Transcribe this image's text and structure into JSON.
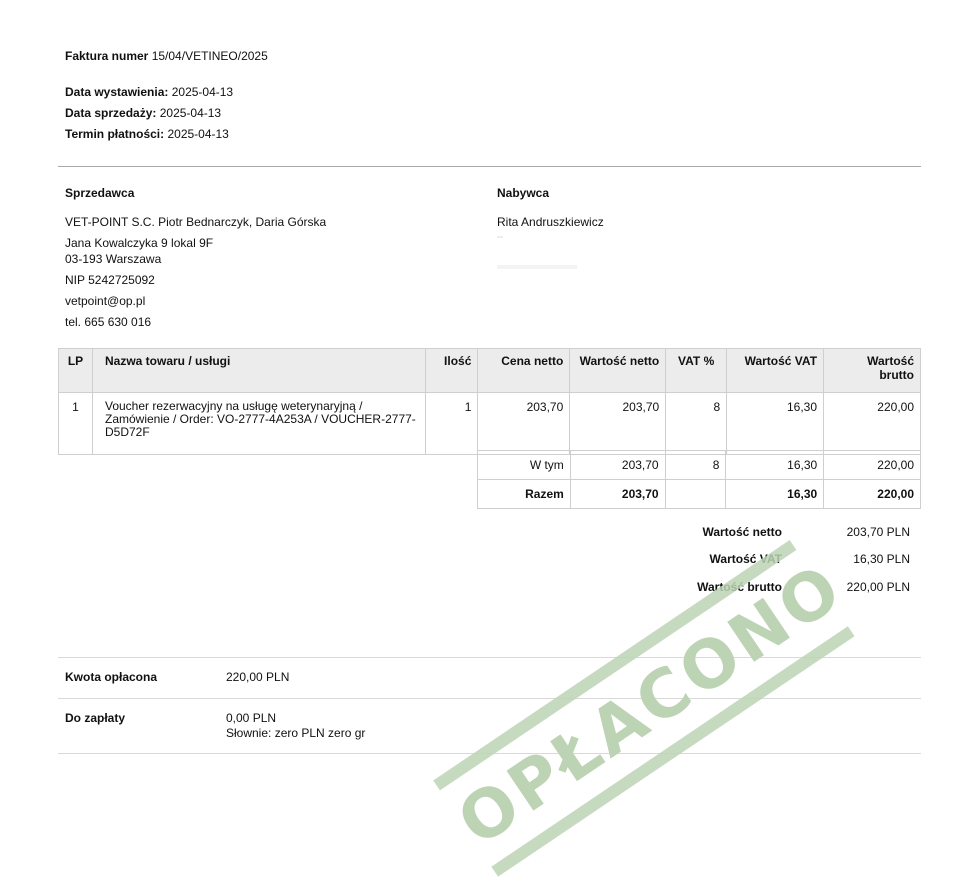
{
  "header": {
    "invoice_label": "Faktura numer",
    "invoice_number": "15/04/VETINEO/2025",
    "issue_label": "Data wystawienia:",
    "issue_date": "2025-04-13",
    "sale_label": "Data sprzedaży:",
    "sale_date": "2025-04-13",
    "due_label": "Termin płatności:",
    "due_date": "2025-04-13"
  },
  "seller": {
    "heading": "Sprzedawca",
    "name": "VET-POINT S.C. Piotr Bednarczyk, Daria Górska",
    "street": "Jana Kowalczyka 9 lokal 9F",
    "city": "03-193 Warszawa",
    "nip": "NIP 5242725092",
    "email": "vetpoint@op.pl",
    "phone": "tel. 665 630 016"
  },
  "buyer": {
    "heading": "Nabywca",
    "name": "Rita Andruszkiewicz"
  },
  "table": {
    "headers": {
      "lp": "LP",
      "name": "Nazwa towaru / usługi",
      "qty": "Ilość",
      "net_price": "Cena netto",
      "net_value": "Wartość netto",
      "vat_pct": "VAT %",
      "vat_value": "Wartość VAT",
      "gross_value": "Wartość brutto"
    },
    "rows": [
      {
        "lp": "1",
        "name": "Voucher rezerwacyjny na usługę weterynaryjną / Zamówienie / Order: VO-2777-4A253A / VOUCHER-2777-D5D72F",
        "qty": "1",
        "net_price": "203,70",
        "net_value": "203,70",
        "vat_pct": "8",
        "vat_value": "16,30",
        "gross_value": "220,00"
      }
    ],
    "subtotal": {
      "label": "W tym",
      "net_value": "203,70",
      "vat_pct": "8",
      "vat_value": "16,30",
      "gross_value": "220,00"
    },
    "total": {
      "label": "Razem",
      "net_value": "203,70",
      "vat_value": "16,30",
      "gross_value": "220,00"
    }
  },
  "summary": {
    "net_label": "Wartość netto",
    "net_value": "203,70 PLN",
    "vat_label": "Wartość VAT",
    "vat_value": "16,30 PLN",
    "gross_label": "Wartość brutto",
    "gross_value": "220,00 PLN"
  },
  "payment": {
    "paid_label": "Kwota opłacona",
    "paid_value": "220,00 PLN",
    "due_label": "Do zapłaty",
    "due_value": "0,00 PLN",
    "due_words": "Słownie: zero PLN zero gr"
  },
  "stamp": {
    "text": "OPŁACONO",
    "color": "#bcd3b4"
  }
}
